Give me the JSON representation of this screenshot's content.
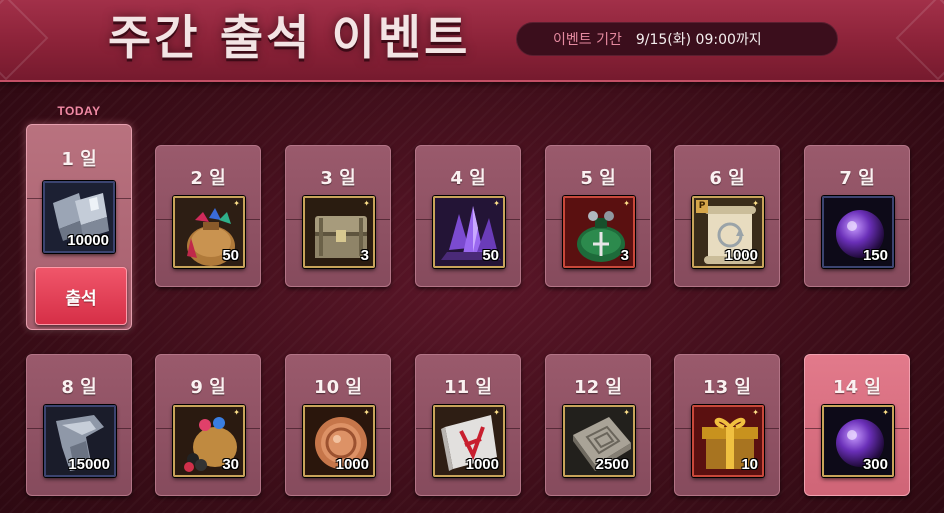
{
  "header": {
    "title": "주간 출석 이벤트",
    "period_label": "이벤트 기간",
    "period_value": "9/15(화) 09:00까지"
  },
  "today_label": "TODAY",
  "attend_button": "출석",
  "days": [
    {
      "label": "1 일",
      "qty": "10000",
      "icon": "metal-ingot-icon",
      "frame": "#3b4470",
      "status": "today"
    },
    {
      "label": "2 일",
      "qty": "50",
      "icon": "gem-pouch-icon",
      "frame": "#c8a45a"
    },
    {
      "label": "3 일",
      "qty": "3",
      "icon": "treasure-chest-icon",
      "frame": "#c8a45a"
    },
    {
      "label": "4 일",
      "qty": "50",
      "icon": "purple-crystal-icon",
      "frame": "#c8a45a"
    },
    {
      "label": "5 일",
      "qty": "3",
      "icon": "green-pouch-icon",
      "frame": "#c8483a"
    },
    {
      "label": "6 일",
      "qty": "1000",
      "icon": "scroll-icon",
      "frame": "#c8a45a",
      "badge": "P"
    },
    {
      "label": "7 일",
      "qty": "150",
      "icon": "purple-orb-icon",
      "frame": "#3b4470"
    },
    {
      "label": "8 일",
      "qty": "15000",
      "icon": "metal-scrap-icon",
      "frame": "#3b4470"
    },
    {
      "label": "9 일",
      "qty": "30",
      "icon": "gem-bag-icon",
      "frame": "#c8a45a"
    },
    {
      "label": "10 일",
      "qty": "1000",
      "icon": "bronze-coin-icon",
      "frame": "#c8a45a"
    },
    {
      "label": "11 일",
      "qty": "1000",
      "icon": "red-rune-scroll-icon",
      "frame": "#c8a45a"
    },
    {
      "label": "12 일",
      "qty": "2500",
      "icon": "stone-tablet-icon",
      "frame": "#c8a45a"
    },
    {
      "label": "13 일",
      "qty": "10",
      "icon": "gift-box-icon",
      "frame": "#c8483a"
    },
    {
      "label": "14 일",
      "qty": "300",
      "icon": "purple-orb-icon",
      "frame": "#c8a45a",
      "status": "highlight"
    }
  ]
}
